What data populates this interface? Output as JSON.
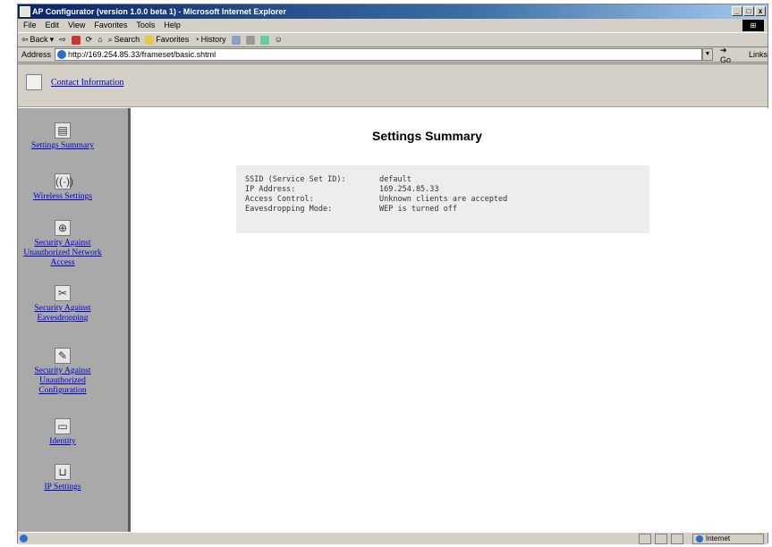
{
  "window": {
    "title": "AP Configurator (version 1.0.0 beta 1) - Microsoft Internet Explorer",
    "controls": [
      "_",
      "□",
      "x"
    ]
  },
  "menu": [
    "File",
    "Edit",
    "View",
    "Favorites",
    "Tools",
    "Help"
  ],
  "toolbar": {
    "back": "Back",
    "search": "Search",
    "favorites": "Favorites",
    "history": "History"
  },
  "address": {
    "label": "Address",
    "url": "http://169.254.85.33/frameset/basic.shtml",
    "go": "Go",
    "links": "Links"
  },
  "top_nav": {
    "contact": "Contact Information"
  },
  "sidebar": {
    "items": [
      {
        "label": "Settings Summary",
        "icon": "summary-icon"
      },
      {
        "label": "Wireless Settings",
        "icon": "wireless-icon"
      },
      {
        "label": "Security Against Unauthorized Network Access",
        "icon": "network-security-icon"
      },
      {
        "label": "Security Against Eavesdropping",
        "icon": "eavesdropping-icon"
      },
      {
        "label": "Security Against Unauthorized Configuration",
        "icon": "configuration-security-icon"
      },
      {
        "label": "Identity",
        "icon": "identity-icon"
      },
      {
        "label": "IP Settings",
        "icon": "ip-settings-icon"
      }
    ]
  },
  "main": {
    "title": "Settings Summary",
    "rows": [
      {
        "key": "SSID (Service Set ID):",
        "value": "default"
      },
      {
        "key": "IP Address:",
        "value": "169.254.85.33"
      },
      {
        "key": "Access Control:",
        "value": "Unknown clients are accepted"
      },
      {
        "key": "Eavesdropping Mode:",
        "value": "WEP is turned off"
      }
    ]
  },
  "status": {
    "zone": "Internet"
  }
}
